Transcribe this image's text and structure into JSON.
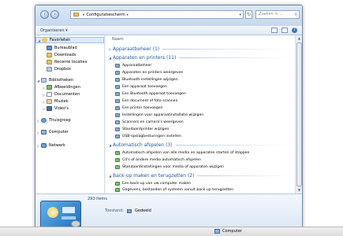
{
  "address": {
    "path": "Configuratiescherm"
  },
  "search": {
    "placeholder": "Zoeken in ..."
  },
  "toolbar": {
    "organize": "Organiseren ▾"
  },
  "nav": {
    "items": [
      {
        "label": "Favorieten",
        "icon": "star-icon"
      },
      {
        "label": "Bureaublad",
        "icon": "desktop-icon"
      },
      {
        "label": "Downloads",
        "icon": "downloads-icon"
      },
      {
        "label": "Recente locaties",
        "icon": "recent-places-icon"
      },
      {
        "label": "Dropbox",
        "icon": "dropbox-icon"
      },
      {
        "label": "Bibliotheken",
        "icon": "libraries-icon"
      },
      {
        "label": "Afbeeldingen",
        "icon": "pictures-icon"
      },
      {
        "label": "Documenten",
        "icon": "documents-icon"
      },
      {
        "label": "Muziek",
        "icon": "music-icon"
      },
      {
        "label": "Video's",
        "icon": "videos-icon"
      },
      {
        "label": "Thuisgroep",
        "icon": "homegroup-icon"
      },
      {
        "label": "Computer",
        "icon": "computer-icon"
      },
      {
        "label": "Netwerk",
        "icon": "network-icon"
      }
    ]
  },
  "content": {
    "column_header": "Naam",
    "groups": [
      {
        "title": "Apparaatbeheer (1)",
        "items": []
      },
      {
        "title": "Apparaten en printers (11)",
        "items": [
          "Apparaatbeheer",
          "Apparaten en printers weergeven",
          "Bluetooth-instellingen wijzigen",
          "Een apparaat toevoegen",
          "Een Bluetooth-apparaat toevoegen",
          "Een document of foto scannen",
          "Een printer toevoegen",
          "Instellingen voor apparaatinstallatie wijzigen",
          "Scanners en camera's weergeven",
          "Standaardprinter wijzigen",
          "USB-opslagbesturingen instellen"
        ]
      },
      {
        "title": "Automatisch afspelen (3)",
        "items": [
          "Automatisch afspelen van alle media en apparaten starten of stoppen",
          "Cd's of andere media automatisch afspelen",
          "Standaardinstellingen voor media of apparaten wijzigen"
        ]
      },
      {
        "title": "Back-up maken en terugzetten (2)",
        "items": [
          "Een back-up van uw computer maken",
          "Gegevens, bestanden of systeem vanuit back-up terugzetten"
        ]
      }
    ]
  },
  "details": {
    "count": "293 items",
    "state_label": "Toestand:",
    "state_value": "Gedeeld"
  },
  "statusbar": {
    "location": "Computer"
  }
}
